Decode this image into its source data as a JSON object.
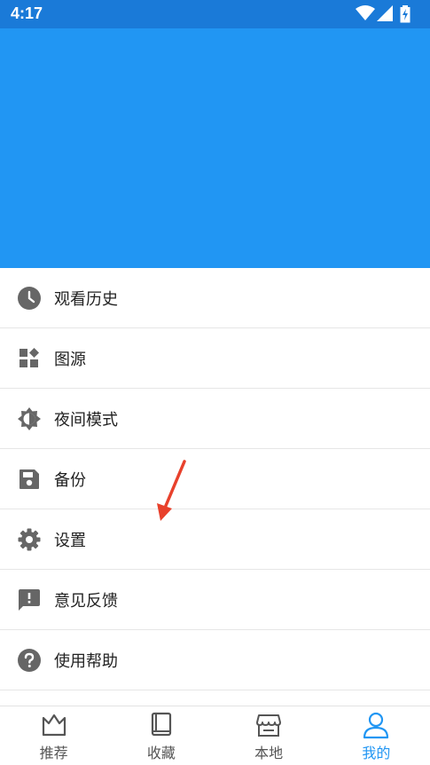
{
  "status_bar": {
    "time": "4:17",
    "icons": [
      "wifi-icon",
      "signal-icon",
      "battery-charging-icon"
    ]
  },
  "menu": {
    "items": [
      {
        "label": "观看历史",
        "icon": "clock-icon"
      },
      {
        "label": "图源",
        "icon": "widgets-icon"
      },
      {
        "label": "夜间模式",
        "icon": "brightness-icon"
      },
      {
        "label": "备份",
        "icon": "save-icon"
      },
      {
        "label": "设置",
        "icon": "gear-icon"
      },
      {
        "label": "意见反馈",
        "icon": "feedback-icon"
      },
      {
        "label": "使用帮助",
        "icon": "help-icon"
      }
    ]
  },
  "bottom_nav": {
    "items": [
      {
        "label": "推荐",
        "icon": "crown-icon",
        "active": false
      },
      {
        "label": "收藏",
        "icon": "book-icon",
        "active": false
      },
      {
        "label": "本地",
        "icon": "store-icon",
        "active": false
      },
      {
        "label": "我的",
        "icon": "person-icon",
        "active": true
      }
    ]
  },
  "colors": {
    "status_bar": "#1a7ad8",
    "header": "#2196f3",
    "accent": "#2196f3",
    "icon_gray": "#666666",
    "annotation": "#e8412c"
  }
}
